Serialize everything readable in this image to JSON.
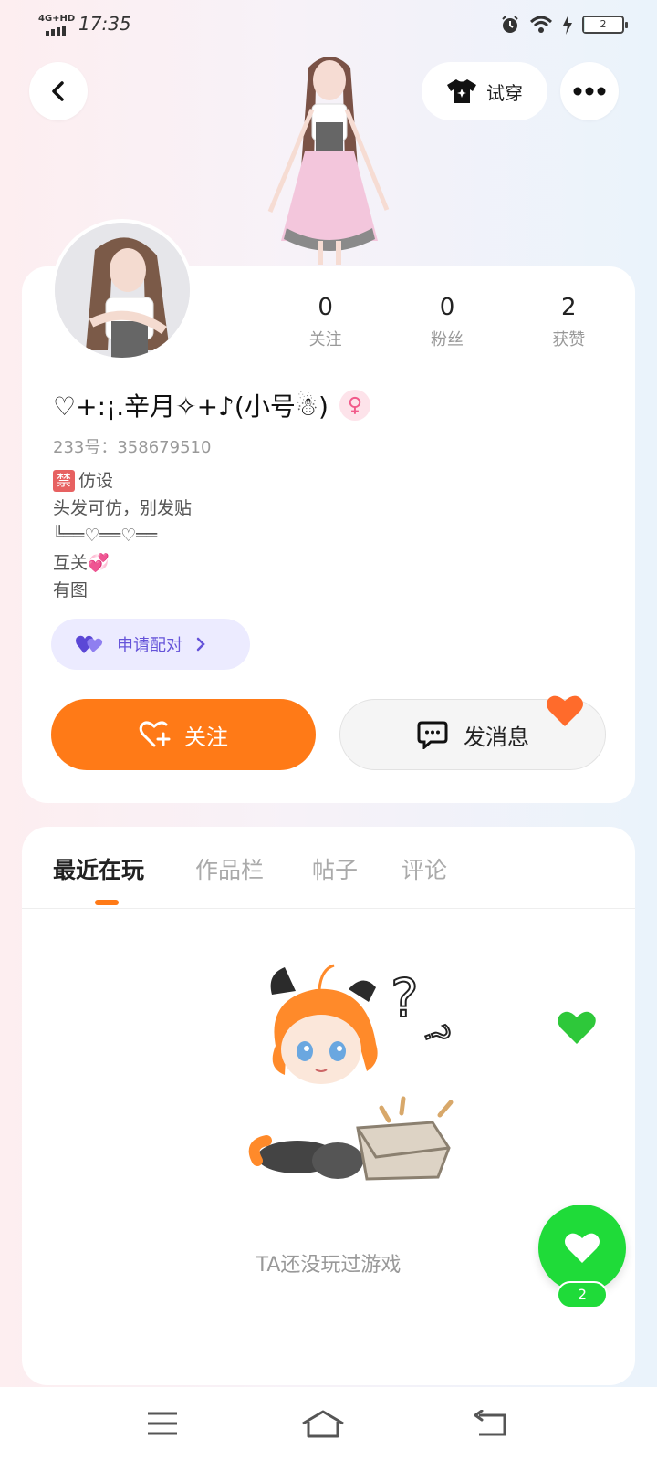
{
  "status_bar": {
    "network": "4G+HD",
    "time": "17:35",
    "battery": "2",
    "battery_level": 0.02
  },
  "header": {
    "try_on_label": "试穿"
  },
  "profile": {
    "stats": [
      {
        "value": "0",
        "label": "关注"
      },
      {
        "value": "0",
        "label": "粉丝"
      },
      {
        "value": "2",
        "label": "获赞"
      }
    ],
    "nickname": "♡+:¡.辛月✧+♪(小号☃)",
    "gender_symbol": "♀",
    "uid": "233号：358679510",
    "bio": {
      "ban_tag": "禁",
      "line1": "仿设",
      "line2": "头发可仿，别发贴",
      "line3": "╚══♡══♡══",
      "line4": "互关💞",
      "line5": "有图"
    },
    "pair_label": "申请配对",
    "follow_label": "关注",
    "message_label": "发消息"
  },
  "tabs": [
    {
      "label": "最近在玩",
      "active": true
    },
    {
      "label": "作品栏",
      "active": false
    },
    {
      "label": "帖子",
      "active": false
    },
    {
      "label": "评论",
      "active": false
    }
  ],
  "empty_state": {
    "text": "TA还没玩过游戏"
  },
  "like": {
    "count": "2"
  },
  "colors": {
    "accent": "#ff7a17",
    "green": "#1fdb39",
    "pair": "#6553d9"
  }
}
